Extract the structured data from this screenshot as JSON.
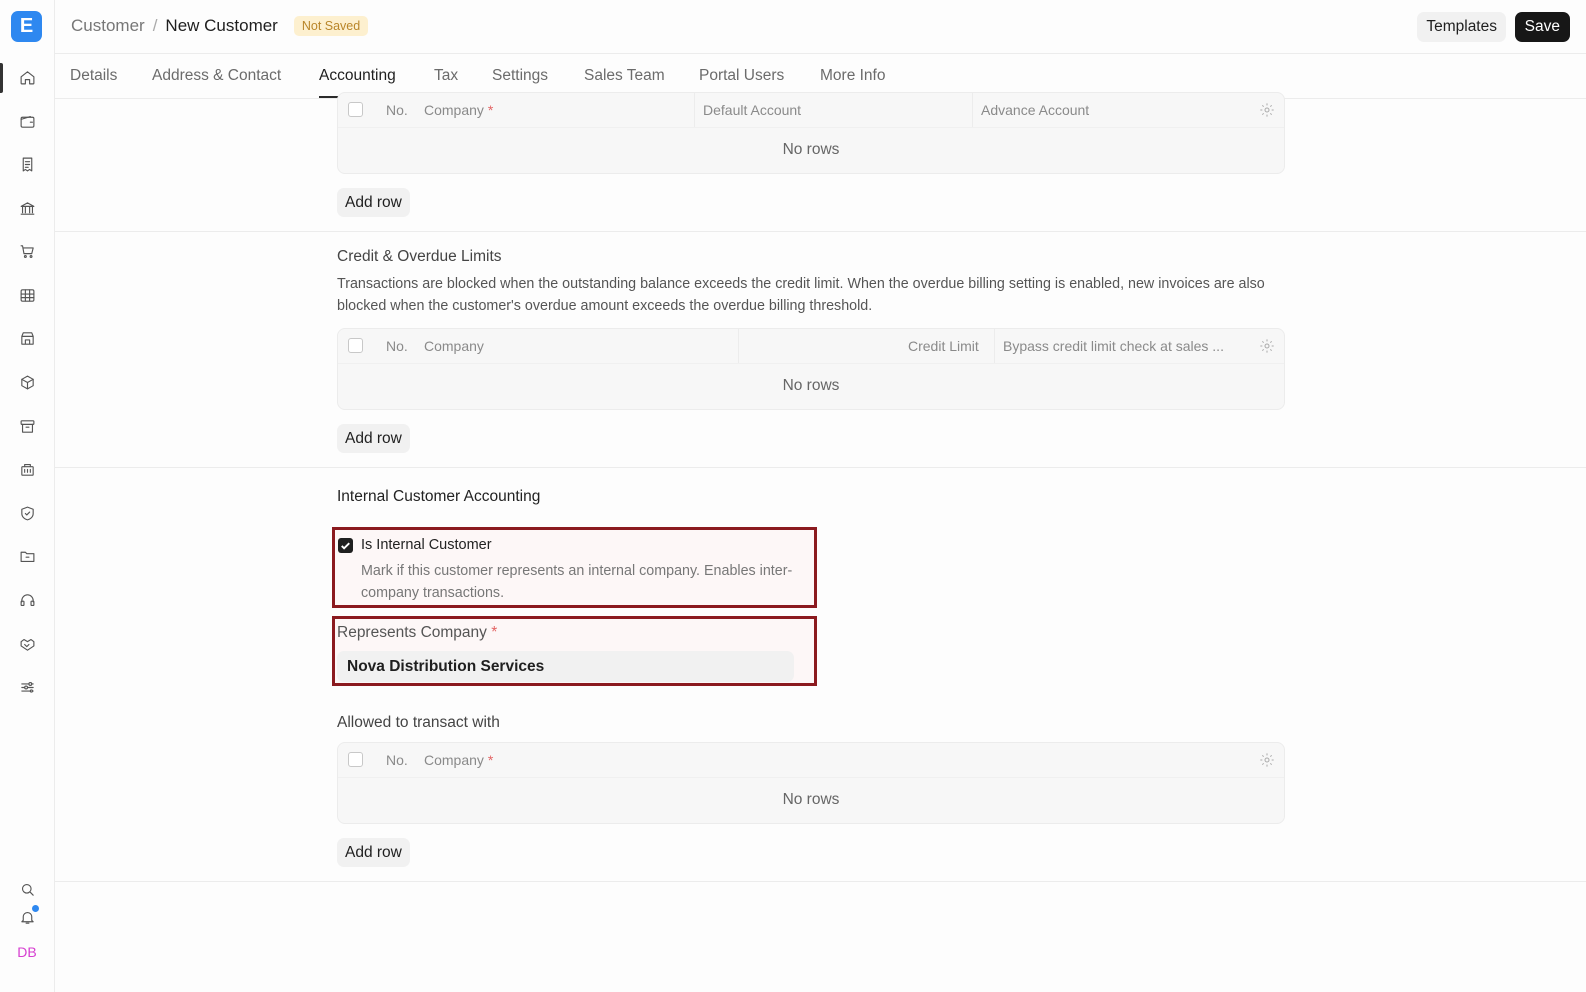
{
  "app": {
    "logo_letter": "E"
  },
  "sidebar": {
    "icons": [
      "home-icon",
      "wallet-icon",
      "receipt-icon",
      "bank-icon",
      "cart-icon",
      "table-icon",
      "store-icon",
      "box-icon",
      "archive-icon",
      "building-icon",
      "shield-icon",
      "folder-icon",
      "headset-icon",
      "handshake-icon",
      "sliders-icon"
    ],
    "bottom_icons": [
      "search-icon",
      "bell-icon"
    ],
    "avatar_initials": "DB"
  },
  "header": {
    "breadcrumb_parent": "Customer",
    "breadcrumb_sep": "/",
    "breadcrumb_current": "New Customer",
    "status_badge": "Not Saved",
    "templates_label": "Templates",
    "save_label": "Save"
  },
  "tabs": [
    {
      "label": "Details"
    },
    {
      "label": "Address & Contact"
    },
    {
      "label": "Accounting",
      "active": true
    },
    {
      "label": "Tax"
    },
    {
      "label": "Settings"
    },
    {
      "label": "Sales Team"
    },
    {
      "label": "Portal Users"
    },
    {
      "label": "More Info"
    }
  ],
  "accounts_table": {
    "columns": [
      "No.",
      "Company",
      "Default Account",
      "Advance Account"
    ],
    "empty_text": "No rows",
    "add_row_label": "Add row"
  },
  "credit_section": {
    "title": "Credit & Overdue Limits",
    "description": "Transactions are blocked when the outstanding balance exceeds the credit limit. When the overdue billing setting is enabled, new invoices are also blocked when the customer's overdue amount exceeds the overdue billing threshold.",
    "columns": [
      "No.",
      "Company",
      "Credit Limit",
      "Bypass credit limit check at sales ..."
    ],
    "empty_text": "No rows",
    "add_row_label": "Add row"
  },
  "internal_section": {
    "title": "Internal Customer Accounting",
    "is_internal_label": "Is Internal Customer",
    "is_internal_checked": true,
    "is_internal_desc": "Mark if this customer represents an internal company. Enables inter-company transactions.",
    "represents_label": "Represents Company",
    "represents_value": "Nova Distribution Services",
    "allowed_title": "Allowed to transact with",
    "columns": [
      "No.",
      "Company"
    ],
    "empty_text": "No rows",
    "add_row_label": "Add row"
  },
  "colors": {
    "accent": "#2e88f0",
    "highlight_border": "#8b1a1f",
    "badge_bg": "#fdf0cf",
    "primary_button": "#171717"
  }
}
